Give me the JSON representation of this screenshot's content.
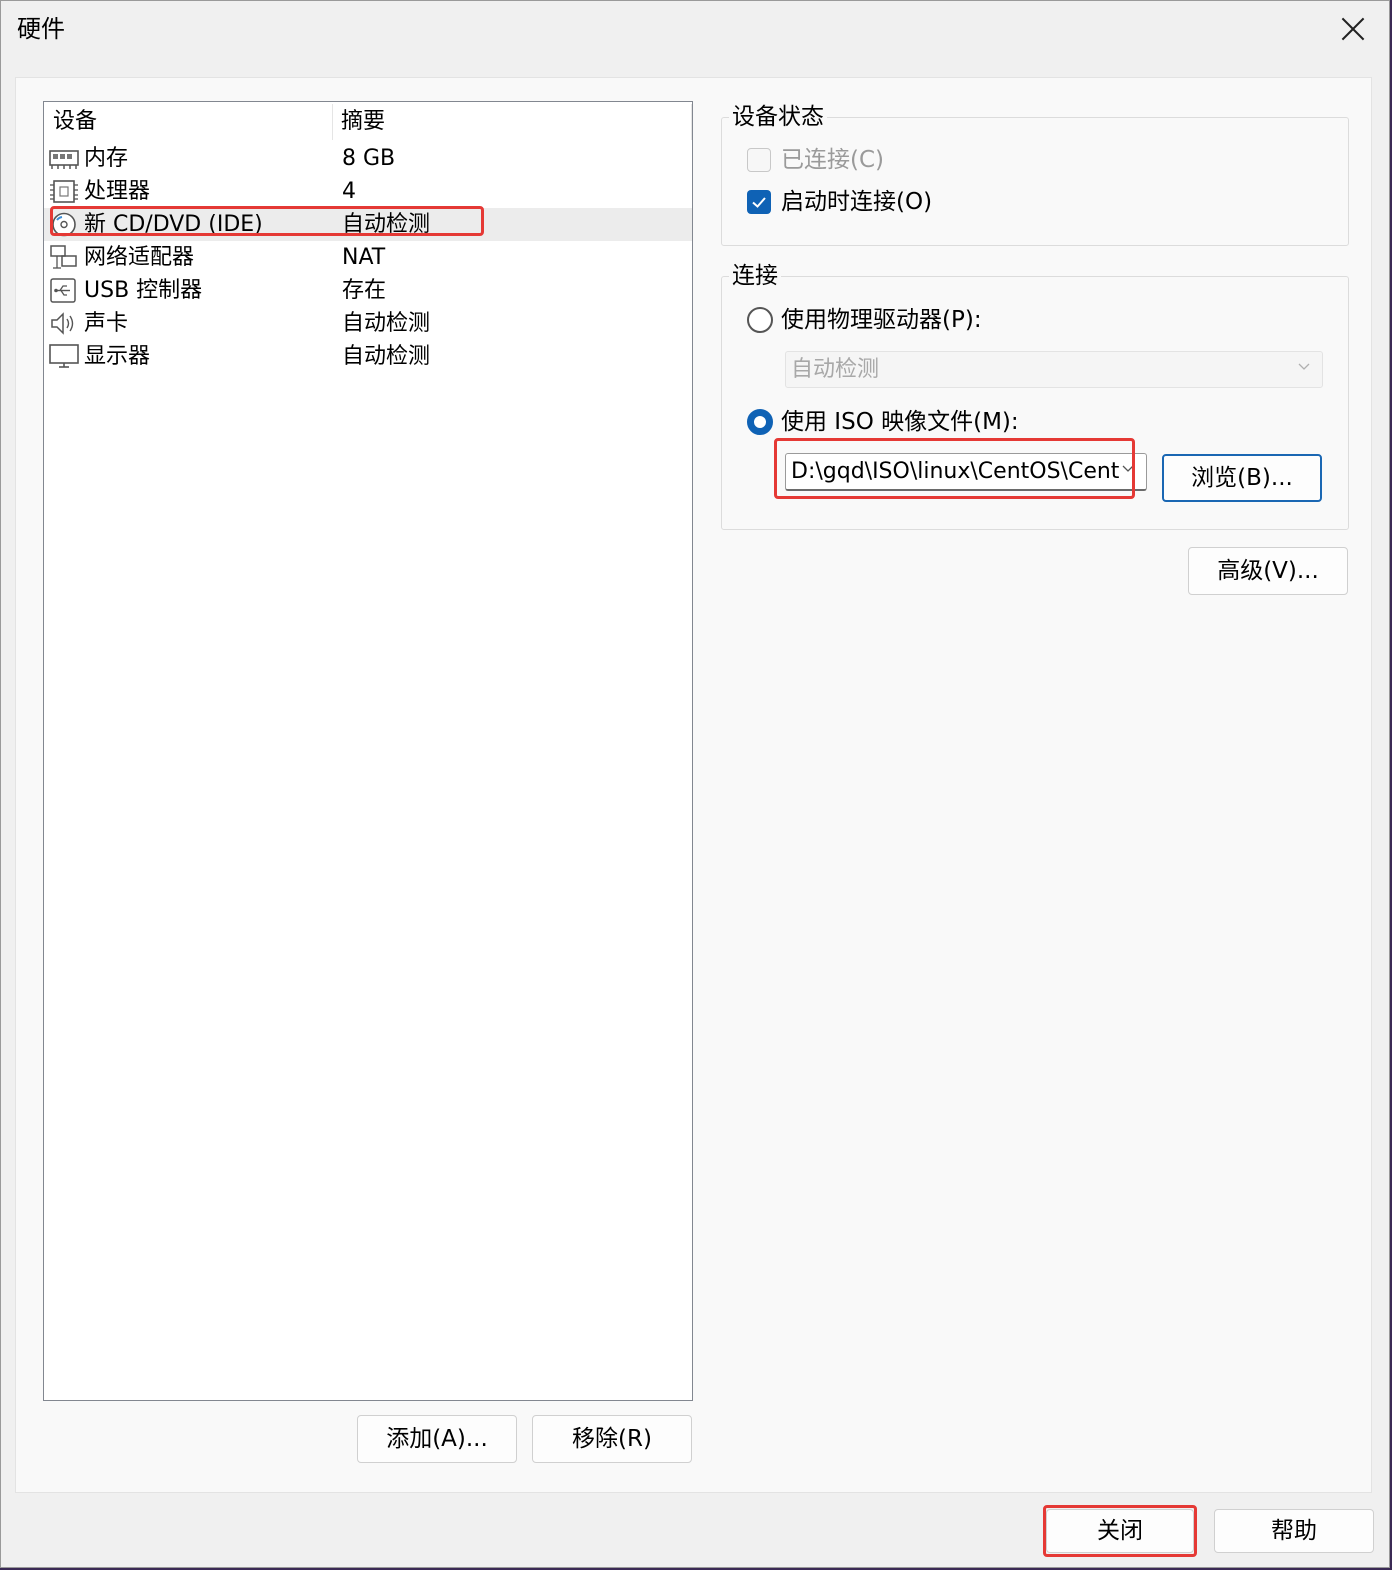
{
  "window": {
    "title": "硬件"
  },
  "device_list": {
    "columns": [
      "设备",
      "摘要"
    ],
    "rows": [
      {
        "icon": "memory-icon",
        "name": "内存",
        "summary": "8 GB"
      },
      {
        "icon": "processor-icon",
        "name": "处理器",
        "summary": "4"
      },
      {
        "icon": "cd-dvd-icon",
        "name": "新 CD/DVD (IDE)",
        "summary": "自动检测",
        "selected": true
      },
      {
        "icon": "network-adapter-icon",
        "name": "网络适配器",
        "summary": "NAT"
      },
      {
        "icon": "usb-controller-icon",
        "name": "USB 控制器",
        "summary": "存在"
      },
      {
        "icon": "sound-card-icon",
        "name": "声卡",
        "summary": "自动检测"
      },
      {
        "icon": "display-icon",
        "name": "显示器",
        "summary": "自动检测"
      }
    ],
    "add_button": "添加(A)...",
    "remove_button": "移除(R)"
  },
  "device_status": {
    "legend": "设备状态",
    "connected_label": "已连接(C)",
    "connected_checked": false,
    "connect_at_power_on_label": "启动时连接(O)",
    "connect_at_power_on_checked": true
  },
  "connection": {
    "legend": "连接",
    "physical_drive_label": "使用物理驱动器(P):",
    "physical_drive_value": "自动检测",
    "iso_label": "使用 ISO 映像文件(M):",
    "iso_path": "D:\\gqd\\ISO\\linux\\CentOS\\Cent",
    "browse_button": "浏览(B)...",
    "selected_option": "iso"
  },
  "advanced_button": "高级(V)...",
  "footer": {
    "close_button": "关闭",
    "help_button": "帮助"
  },
  "colors": {
    "accent": "#0f62b5",
    "highlight": "#e53935"
  }
}
